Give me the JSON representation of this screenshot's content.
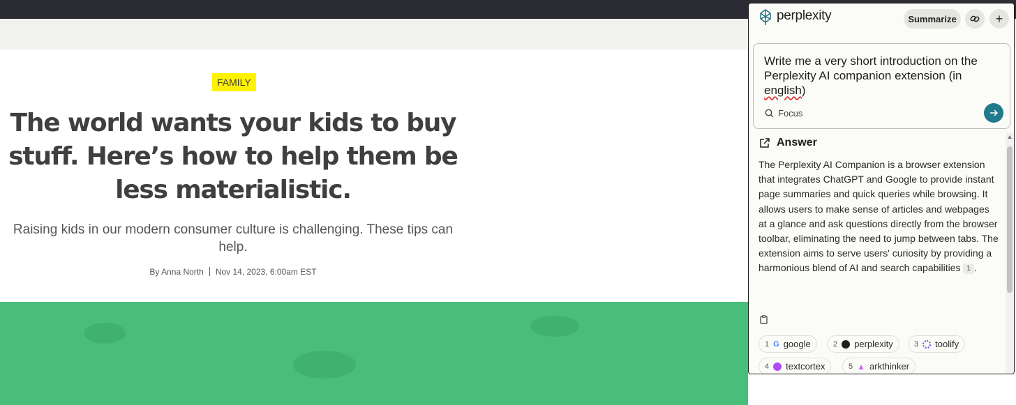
{
  "article": {
    "tag": "FAMILY",
    "headline": "The world wants your kids to buy stuff. Here’s how to help them be less materialistic.",
    "dek": "Raising kids in our modern consumer culture is challenging. These tips can help.",
    "byline_prefix": "By ",
    "author": "Anna North",
    "date": "Nov 14, 2023, 6:00am EST"
  },
  "panel": {
    "brand": "perplexity",
    "summarize_label": "Summarize",
    "link_icon": "link-icon",
    "plus_label": "+",
    "query_before": "Write me a very short introduction on the Perplexity AI companion extension (in ",
    "query_squiggle": "english",
    "query_after": ")",
    "focus_label": "Focus",
    "answer_title": "Answer",
    "answer_text": "The Perplexity AI Companion is a browser extension that integrates ChatGPT and Google to provide instant page summaries and quick queries while browsing. It allows users to make sense of articles and webpages at a glance and ask questions directly from the browser toolbar, eliminating the need to jump between tabs. The extension aims to serve users' curiosity by providing a harmonious blend of AI and search capabilities",
    "citation": "1",
    "answer_end": ".",
    "sources": [
      {
        "num": "1",
        "label": "google",
        "icon": "google-icon",
        "color": "#4285f4"
      },
      {
        "num": "2",
        "label": "perplexity",
        "icon": "perplexity-icon",
        "color": "#1f1f1f"
      },
      {
        "num": "3",
        "label": "toolify",
        "icon": "toolify-icon",
        "color": "#6b4cf5"
      },
      {
        "num": "4",
        "label": "textcortex",
        "icon": "textcortex-icon",
        "color": "#b04cf5"
      },
      {
        "num": "5",
        "label": "arkthinker",
        "icon": "arkthinker-icon",
        "color": "#c86bf0"
      }
    ]
  },
  "colors": {
    "tag_bg": "#fff200",
    "hero_green": "#49bd7a",
    "accent_teal": "#1f7a8c"
  }
}
